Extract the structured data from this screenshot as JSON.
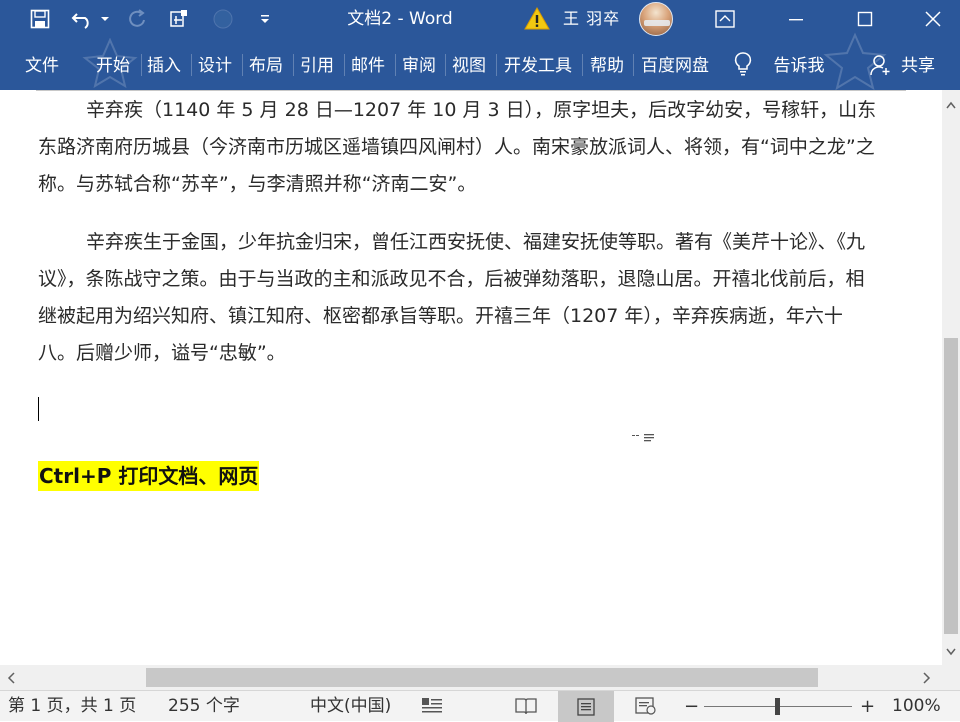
{
  "titlebar": {
    "doc_title": "文档2  -  Word",
    "user_name": "王 羽卒",
    "quick_access": [
      "save-icon",
      "undo-icon",
      "redo-icon",
      "touch-mode-icon",
      "circle-icon",
      "customize-dropdown-icon"
    ],
    "warning_icon": "warning-icon",
    "controls": [
      "ribbon-display-options-icon",
      "minimize-icon",
      "maximize-icon",
      "close-icon"
    ]
  },
  "ribbon": {
    "tabs": [
      "文件",
      "开始",
      "插入",
      "设计",
      "布局",
      "引用",
      "邮件",
      "审阅",
      "视图",
      "开发工具",
      "帮助",
      "百度网盘"
    ],
    "tell_me": "告诉我",
    "share": "共享",
    "accent_color": "#2b579a"
  },
  "document": {
    "paragraph1": "辛弃疾（1140 年 5 月 28 日—1207 年 10 月 3 日），原字坦夫，后改字幼安，号稼轩，山东东路济南府历城县（今济南市历城区遥墙镇四风闸村）人。南宋豪放派词人、将领，有“词中之龙”之称。与苏轼合称“苏辛”，与李清照并称“济南二安”。",
    "paragraph2": "辛弃疾生于金国，少年抗金归宋，曾任江西安抚使、福建安抚使等职。著有《美芹十论》、《九议》，条陈战守之策。由于与当政的主和派政见不合，后被弹劾落职，退隐山居。开禧北伐前后，相继被起用为绍兴知府、镇江知府、枢密都承旨等职。开禧三年（1207 年），辛弃疾病逝，年六十八。后赠少师，谥号“忠敏”。",
    "shortcut_caption": "Ctrl+P 打印文档、网页",
    "highlight_color": "#ffff00"
  },
  "statusbar": {
    "page_info": "第 1 页，共 1 页",
    "word_count": "255 个字",
    "language": "中文(中国)",
    "zoom_level": "100%",
    "zoom_minus": "−",
    "zoom_plus": "+"
  }
}
